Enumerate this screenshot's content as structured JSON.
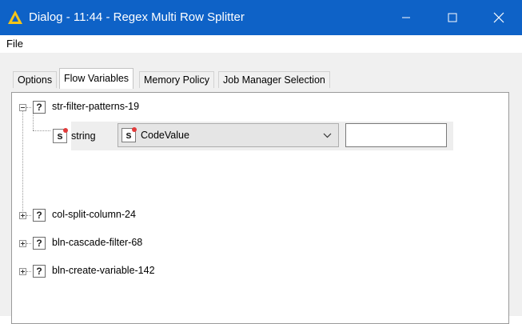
{
  "window": {
    "title": "Dialog - 11:44 - Regex Multi Row Splitter",
    "app_icon": "knime-triangle-icon",
    "controls": [
      "minimize-icon",
      "maximize-icon",
      "close-icon"
    ]
  },
  "menu": {
    "file": "File"
  },
  "tabs": [
    {
      "label": "Options",
      "active": false
    },
    {
      "label": "Flow Variables",
      "active": true
    },
    {
      "label": "Memory Policy",
      "active": false
    },
    {
      "label": "Job Manager Selection",
      "active": false
    }
  ],
  "tree": {
    "nodes": [
      {
        "label": "str-filter-patterns-19",
        "expanded": true
      },
      {
        "label": "col-split-column-24",
        "expanded": false
      },
      {
        "label": "bln-cascade-filter-68",
        "expanded": false
      },
      {
        "label": "bln-create-variable-142",
        "expanded": false
      }
    ],
    "child": {
      "type_label": "string",
      "type_icon": "s",
      "selected_variable": "CodeValue",
      "text_value": ""
    }
  },
  "colors": {
    "titlebar": "#0e62c7",
    "panel": "#f0f0f0",
    "accent_dot": "#e23b3b"
  }
}
